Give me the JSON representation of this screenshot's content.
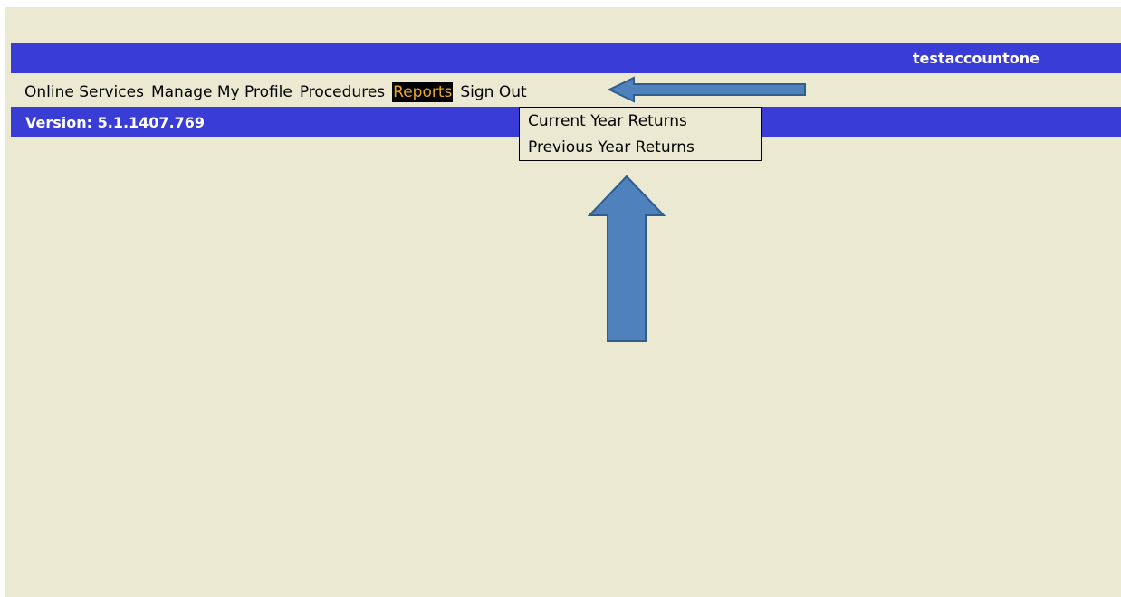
{
  "header": {
    "username": "testaccountone"
  },
  "menu": {
    "items": [
      {
        "label": "Online Services"
      },
      {
        "label": "Manage My Profile"
      },
      {
        "label": "Procedures"
      },
      {
        "label": "Reports"
      },
      {
        "label": "Sign Out"
      }
    ],
    "active": "Reports"
  },
  "version": {
    "text": "Version: 5.1.1407.769"
  },
  "reports_dropdown": {
    "items": [
      {
        "label": "Current Year Returns"
      },
      {
        "label": "Previous Year Returns"
      }
    ]
  },
  "colors": {
    "page_background": "#ece9d3",
    "bar_blue": "#3a3cd6",
    "active_text": "#e8a72a",
    "annotation_arrow": "#4f81bd"
  },
  "annotations": {
    "arrows": [
      {
        "points_to": "reports-menu-item",
        "direction": "left"
      },
      {
        "points_to": "reports-dropdown",
        "direction": "up"
      }
    ]
  }
}
